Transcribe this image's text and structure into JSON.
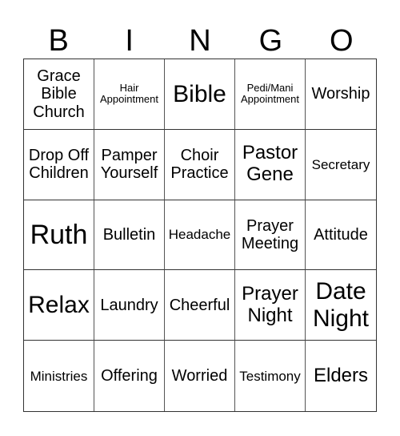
{
  "header": [
    "B",
    "I",
    "N",
    "G",
    "O"
  ],
  "cells": [
    {
      "text": "Grace Bible Church",
      "size": "m"
    },
    {
      "text": "Hair Appointment",
      "size": "xs"
    },
    {
      "text": "Bible",
      "size": "xl"
    },
    {
      "text": "Pedi/Mani Appointment",
      "size": "xs"
    },
    {
      "text": "Worship",
      "size": "m"
    },
    {
      "text": "Drop Off Children",
      "size": "m"
    },
    {
      "text": "Pamper Yourself",
      "size": "m"
    },
    {
      "text": "Choir Practice",
      "size": "m"
    },
    {
      "text": "Pastor Gene",
      "size": "l"
    },
    {
      "text": "Secretary",
      "size": "s"
    },
    {
      "text": "Ruth",
      "size": "xxl"
    },
    {
      "text": "Bulletin",
      "size": "m"
    },
    {
      "text": "Headache",
      "size": "s"
    },
    {
      "text": "Prayer Meeting",
      "size": "m"
    },
    {
      "text": "Attitude",
      "size": "m"
    },
    {
      "text": "Relax",
      "size": "xl"
    },
    {
      "text": "Laundry",
      "size": "m"
    },
    {
      "text": "Cheerful",
      "size": "m"
    },
    {
      "text": "Prayer Night",
      "size": "l"
    },
    {
      "text": "Date Night",
      "size": "xl"
    },
    {
      "text": "Ministries",
      "size": "s"
    },
    {
      "text": "Offering",
      "size": "m"
    },
    {
      "text": "Worried",
      "size": "m"
    },
    {
      "text": "Testimony",
      "size": "s"
    },
    {
      "text": "Elders",
      "size": "l"
    }
  ]
}
